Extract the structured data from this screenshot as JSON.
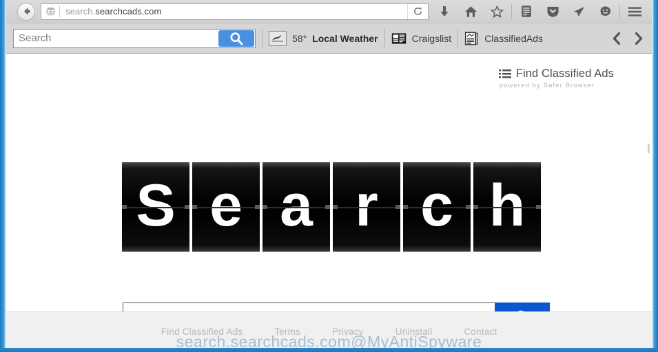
{
  "browser": {
    "back_icon": "back-arrow-icon",
    "favicon": "globe-icon",
    "url_prefix": "search.",
    "url_domain": "searchcads.com",
    "url_full": "search.searchcads.com",
    "reload_icon": "reload-icon",
    "toolbar_icons": [
      {
        "name": "download-icon",
        "glyph": "↓"
      },
      {
        "name": "home-icon",
        "glyph": "⌂"
      },
      {
        "name": "bookmark-star-icon",
        "glyph": "☆"
      },
      {
        "name": "reader-list-icon",
        "glyph": "▤"
      },
      {
        "name": "pocket-shield-icon",
        "glyph": "▼"
      },
      {
        "name": "send-paper-plane-icon",
        "glyph": "➤"
      },
      {
        "name": "smiley-feedback-icon",
        "glyph": "☺"
      },
      {
        "name": "hamburger-menu-icon",
        "glyph": "☰"
      }
    ]
  },
  "extension_bar": {
    "search_placeholder": "Search",
    "search_value": "",
    "search_button_icon": "magnifier-icon",
    "accent_color": "#4a90e2",
    "weather": {
      "icon": "cloud-icon",
      "temperature": "58°",
      "label": "Local Weather"
    },
    "links": [
      {
        "label": "Craigslist",
        "icon": "newspaper-icon"
      },
      {
        "label": "ClassifiedAds",
        "icon": "document-icon"
      }
    ],
    "prev_icon": "chevron-left-icon",
    "next_icon": "chevron-right-icon"
  },
  "page": {
    "brand": {
      "icon": "list-lines-icon",
      "title": "Find Classified Ads",
      "subtitle": "powered by Safer Browser"
    },
    "logo": {
      "style": "flip-board",
      "letters": [
        "S",
        "e",
        "a",
        "r",
        "c",
        "h"
      ],
      "text": "Search"
    },
    "search": {
      "value": "",
      "placeholder": "",
      "button_icon": "magnifier-icon",
      "button_color": "#0b57d0"
    },
    "footer_links": [
      "Find Classified Ads",
      "Terms",
      "Privacy",
      "Uninstall",
      "Contact"
    ],
    "watermark": "search.searchcads.com@MyAntiSpyware"
  }
}
